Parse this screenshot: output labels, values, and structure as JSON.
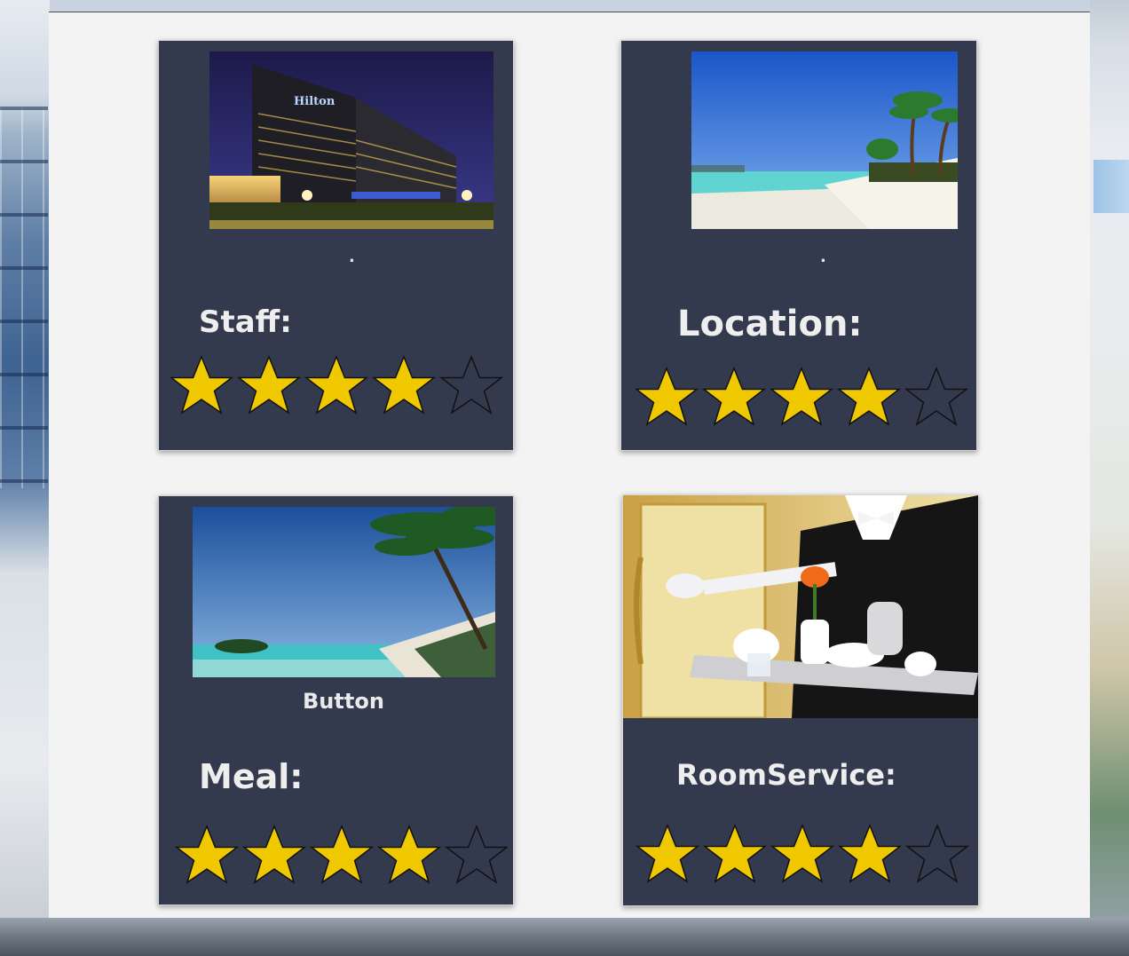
{
  "cards": [
    {
      "label": "Staff:",
      "caption": ".",
      "photo": "hotel-building-night",
      "rating": 4,
      "max_rating": 5
    },
    {
      "label": "Location:",
      "caption": ".",
      "photo": "tropical-beach",
      "rating": 4,
      "max_rating": 5
    },
    {
      "label": "Meal:",
      "caption": "Button",
      "photo": "beach-with-island",
      "rating": 4,
      "max_rating": 5
    },
    {
      "label": "RoomService:",
      "caption": "",
      "photo": "butler-with-tea-tray",
      "rating": 4,
      "max_rating": 5
    }
  ],
  "colors": {
    "card_bg": "#343a4e",
    "panel_bg": "#f3f3f3",
    "star_fill": "#f0c800",
    "text": "#eeeeee"
  },
  "hotel_sign_text": "Hilton"
}
